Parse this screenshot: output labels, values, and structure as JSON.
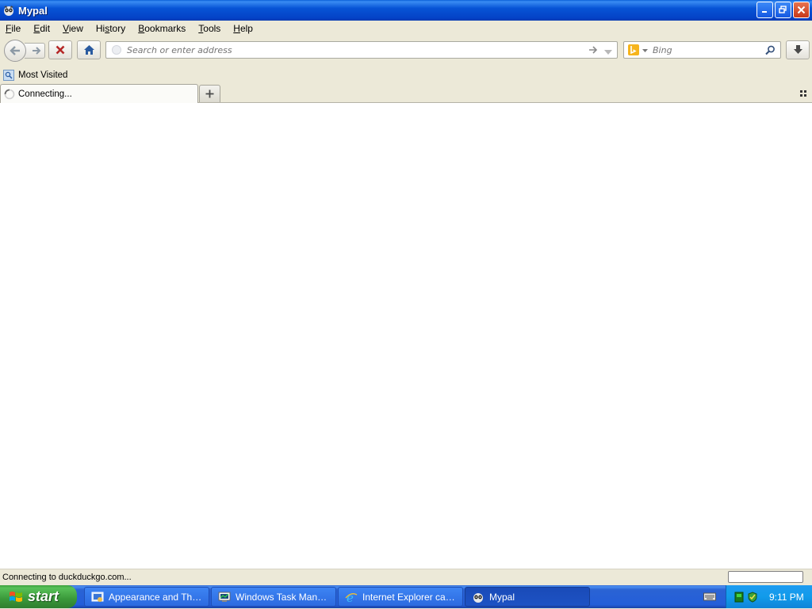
{
  "window": {
    "title": "Mypal"
  },
  "menu": [
    {
      "label_pre": "",
      "label_u": "F",
      "label_post": "ile"
    },
    {
      "label_pre": "",
      "label_u": "E",
      "label_post": "dit"
    },
    {
      "label_pre": "",
      "label_u": "V",
      "label_post": "iew"
    },
    {
      "label_pre": "Hi",
      "label_u": "s",
      "label_post": "tory"
    },
    {
      "label_pre": "",
      "label_u": "B",
      "label_post": "ookmarks"
    },
    {
      "label_pre": "",
      "label_u": "T",
      "label_post": "ools"
    },
    {
      "label_pre": "",
      "label_u": "H",
      "label_post": "elp"
    }
  ],
  "navbar": {
    "url_placeholder": "Search or enter address",
    "url_value": "",
    "search_engine": "Bing",
    "search_placeholder": "Bing"
  },
  "bookmarks": {
    "most_visited": "Most Visited"
  },
  "tabs": [
    {
      "label": "Connecting...",
      "loading": true
    }
  ],
  "status": {
    "text": "Connecting to duckduckgo.com..."
  },
  "taskbar": {
    "start_label": "start",
    "tasks": [
      {
        "label": "Appearance and The...",
        "icon": "control-panel-icon"
      },
      {
        "label": "Windows Task Manager",
        "icon": "task-manager-icon"
      },
      {
        "label": "Internet Explorer can...",
        "icon": "internet-explorer-icon"
      },
      {
        "label": "Mypal",
        "icon": "mypal-icon",
        "active": true
      }
    ],
    "clock": "9:11 PM"
  },
  "colors": {
    "titlebar": "#0754d6",
    "taskbar": "#245ed9",
    "start": "#3a983a",
    "close": "#c5381a"
  }
}
